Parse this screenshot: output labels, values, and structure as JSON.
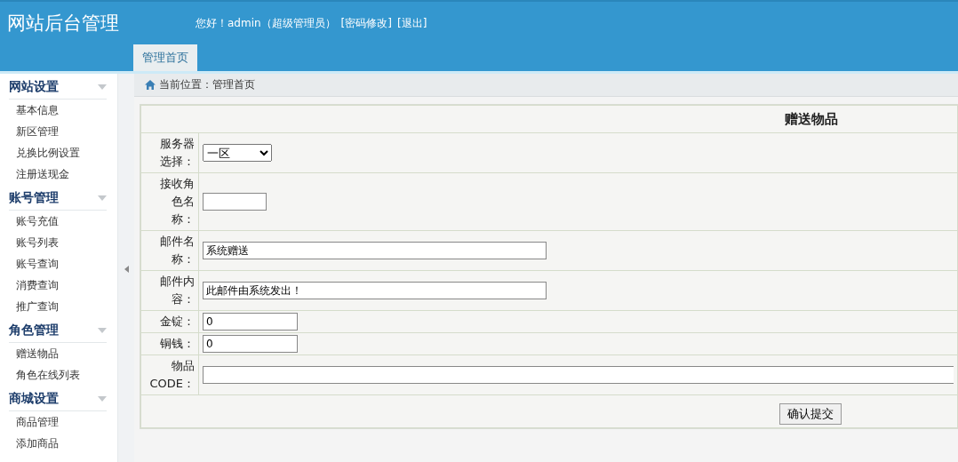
{
  "header": {
    "title": "网站后台管理",
    "greeting": "您好！admin（超级管理员）",
    "links": [
      "[密码修改]",
      "[退出]"
    ]
  },
  "tabs": [
    {
      "label": "管理首页",
      "selected": true
    }
  ],
  "sidebar": {
    "groups": [
      {
        "title": "网站设置",
        "expanded": true,
        "items": [
          "基本信息",
          "新区管理",
          "兑换比例设置",
          "注册送现金"
        ]
      },
      {
        "title": "账号管理",
        "expanded": true,
        "items": [
          "账号充值",
          "账号列表",
          "账号查询",
          "消费查询",
          "推广查询"
        ]
      },
      {
        "title": "角色管理",
        "expanded": true,
        "items": [
          "赠送物品",
          "角色在线列表"
        ]
      },
      {
        "title": "商城设置",
        "expanded": true,
        "items": [
          "商品管理",
          "添加商品"
        ]
      }
    ]
  },
  "breadcrumb": "当前位置：管理首页",
  "form": {
    "title": "赠送物品",
    "fields": [
      {
        "kind": "select",
        "label": "服务器选择：",
        "value": "一区"
      },
      {
        "kind": "short",
        "label": "接收角色名称："
      },
      {
        "kind": "long",
        "label": "邮件名称：",
        "value": "系统赠送"
      },
      {
        "kind": "long",
        "label": "邮件内容：",
        "value": "此邮件由系统发出！"
      },
      {
        "kind": "medium",
        "label": "金锭：",
        "value": "0"
      },
      {
        "kind": "medium",
        "label": "铜钱：",
        "value": "0"
      },
      {
        "kind": "full",
        "label": "物品CODE："
      }
    ],
    "submit": "确认提交"
  }
}
